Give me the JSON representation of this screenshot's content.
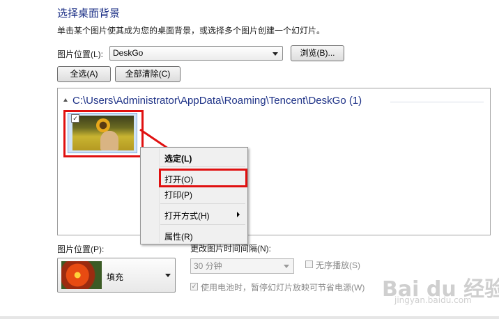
{
  "header": {
    "title": "选择桌面背景",
    "description": "单击某个图片使其成为您的桌面背景，或选择多个图片创建一个幻灯片。"
  },
  "location": {
    "label": "图片位置(L):",
    "value": "DeskGo",
    "browse_label": "浏览(B)..."
  },
  "actions": {
    "select_all_label": "全选(A)",
    "clear_all_label": "全部清除(C)"
  },
  "gallery": {
    "group_header": "C:\\Users\\Administrator\\AppData\\Roaming\\Tencent\\DeskGo (1)",
    "items": [
      {
        "checked": true,
        "checkmark": "✓"
      }
    ]
  },
  "context_menu": {
    "items": [
      {
        "label": "选定(L)"
      },
      {
        "label": "打开(O)"
      },
      {
        "label": "打印(P)"
      },
      {
        "label": "打开方式(H)"
      },
      {
        "label": "属性(R)"
      }
    ]
  },
  "picture_position": {
    "label": "图片位置(P):",
    "value": "填充"
  },
  "slideshow": {
    "interval_label": "更改图片时间间隔(N):",
    "interval_value": "30 分钟",
    "shuffle_label": "无序播放(S)",
    "shuffle_checked": false,
    "battery_label": "使用电池时，暂停幻灯片放映可节省电源(W)",
    "battery_checked": true,
    "battery_checkmark": "✓"
  },
  "watermark": {
    "brand": "Bai du 经验",
    "url": "jingyan.baidu.com"
  },
  "colors": {
    "title_blue": "#1e3287",
    "highlight_red": "#e01010"
  }
}
